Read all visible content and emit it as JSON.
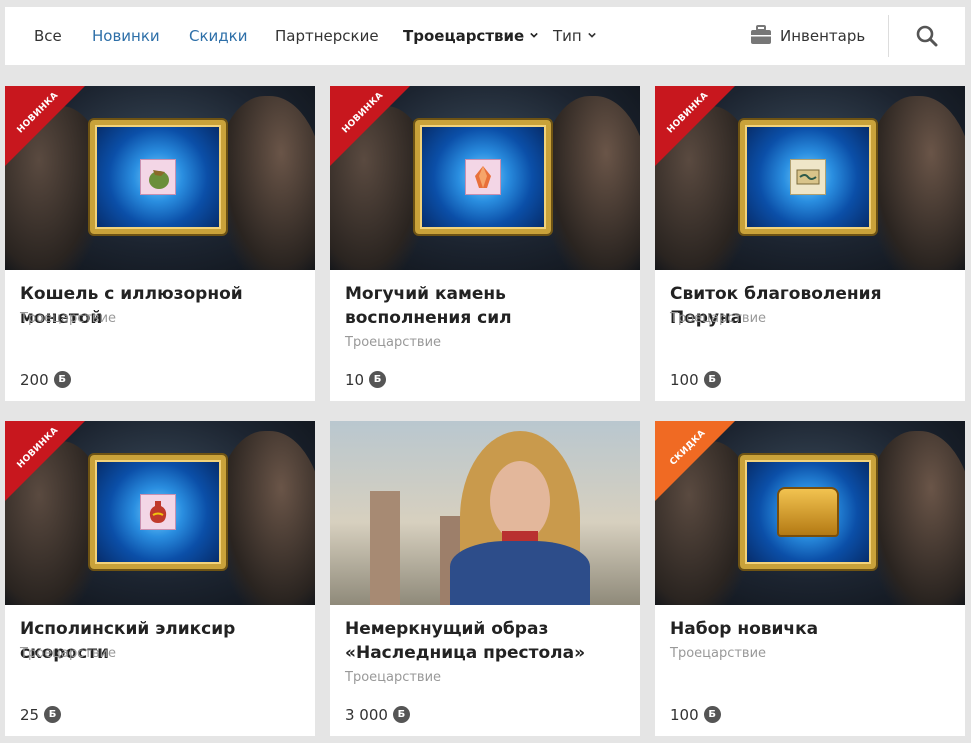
{
  "nav": {
    "tabs": [
      {
        "label": "Все"
      },
      {
        "label": "Новинки"
      },
      {
        "label": "Скидки"
      },
      {
        "label": "Партнерские"
      },
      {
        "label": "Троецарствие"
      },
      {
        "label": "Тип"
      }
    ],
    "inventory_label": "Инвентарь"
  },
  "products": [
    {
      "title": "Кошель с иллюзорной монетой",
      "category": "Троецарствие",
      "price": "200",
      "badge": "НОВИНКА"
    },
    {
      "title": "Могучий камень восполнения сил",
      "category": "Троецарствие",
      "price": "10",
      "badge": "НОВИНКА"
    },
    {
      "title": "Свиток благоволения Перуна",
      "category": "Троецарствие",
      "price": "100",
      "badge": "НОВИНКА"
    },
    {
      "title": "Исполинский эликсир скорости",
      "category": "Троецарствие",
      "price": "25",
      "badge": "НОВИНКА"
    },
    {
      "title": "Немеркнущий образ «Наследница престола»",
      "category": "Троецарствие",
      "price": "3 000",
      "badge": ""
    },
    {
      "title": "Набор новичка",
      "category": "Троецарствие",
      "price": "100",
      "badge": "СКИДКА"
    }
  ],
  "currency_symbol": "Б",
  "colors": {
    "link_blue": "#2d6fa8",
    "badge_new": "#c8171e",
    "badge_sale": "#f06a23",
    "background": "#e5e5e5"
  }
}
